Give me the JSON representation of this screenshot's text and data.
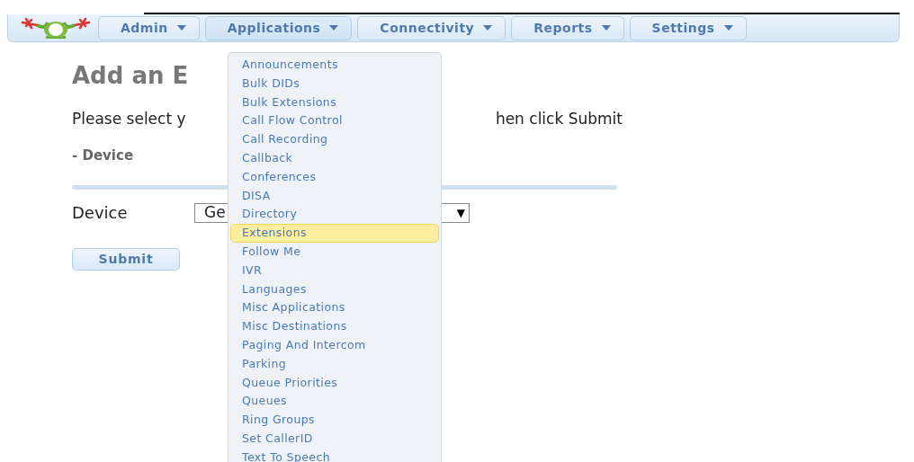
{
  "navbar": {
    "menus": [
      {
        "label": "Admin",
        "open": false
      },
      {
        "label": "Applications",
        "open": true
      },
      {
        "label": "Connectivity",
        "open": false
      },
      {
        "label": "Reports",
        "open": false
      },
      {
        "label": "Settings",
        "open": false
      }
    ]
  },
  "dropdown": {
    "items": [
      {
        "label": "Announcements",
        "selected": false
      },
      {
        "label": "Bulk DIDs",
        "selected": false
      },
      {
        "label": "Bulk Extensions",
        "selected": false
      },
      {
        "label": "Call Flow Control",
        "selected": false
      },
      {
        "label": "Call Recording",
        "selected": false
      },
      {
        "label": "Callback",
        "selected": false
      },
      {
        "label": "Conferences",
        "selected": false
      },
      {
        "label": "DISA",
        "selected": false
      },
      {
        "label": "Directory",
        "selected": false
      },
      {
        "label": "Extensions",
        "selected": true
      },
      {
        "label": "Follow Me",
        "selected": false
      },
      {
        "label": "IVR",
        "selected": false
      },
      {
        "label": "Languages",
        "selected": false
      },
      {
        "label": "Misc Applications",
        "selected": false
      },
      {
        "label": "Misc Destinations",
        "selected": false
      },
      {
        "label": "Paging And Intercom",
        "selected": false
      },
      {
        "label": "Parking",
        "selected": false
      },
      {
        "label": "Queue Priorities",
        "selected": false
      },
      {
        "label": "Queues",
        "selected": false
      },
      {
        "label": "Ring Groups",
        "selected": false
      },
      {
        "label": "Set CallerID",
        "selected": false
      },
      {
        "label": "Text To Speech",
        "selected": false
      }
    ]
  },
  "page": {
    "heading": "Add an E",
    "instruction_left": "Please select y",
    "instruction_right": "hen click Submit",
    "section": "- Device",
    "device_label": "Device",
    "device_value": "Ge",
    "device_arrow": "▼",
    "submit": "Submit"
  }
}
